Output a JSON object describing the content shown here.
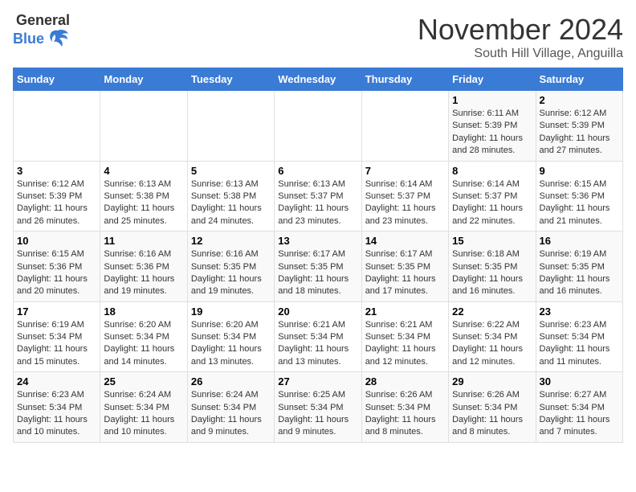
{
  "logo": {
    "general": "General",
    "blue": "Blue"
  },
  "title": "November 2024",
  "subtitle": "South Hill Village, Anguilla",
  "days_of_week": [
    "Sunday",
    "Monday",
    "Tuesday",
    "Wednesday",
    "Thursday",
    "Friday",
    "Saturday"
  ],
  "weeks": [
    [
      {
        "day": "",
        "info": ""
      },
      {
        "day": "",
        "info": ""
      },
      {
        "day": "",
        "info": ""
      },
      {
        "day": "",
        "info": ""
      },
      {
        "day": "",
        "info": ""
      },
      {
        "day": "1",
        "info": "Sunrise: 6:11 AM\nSunset: 5:39 PM\nDaylight: 11 hours and 28 minutes."
      },
      {
        "day": "2",
        "info": "Sunrise: 6:12 AM\nSunset: 5:39 PM\nDaylight: 11 hours and 27 minutes."
      }
    ],
    [
      {
        "day": "3",
        "info": "Sunrise: 6:12 AM\nSunset: 5:39 PM\nDaylight: 11 hours and 26 minutes."
      },
      {
        "day": "4",
        "info": "Sunrise: 6:13 AM\nSunset: 5:38 PM\nDaylight: 11 hours and 25 minutes."
      },
      {
        "day": "5",
        "info": "Sunrise: 6:13 AM\nSunset: 5:38 PM\nDaylight: 11 hours and 24 minutes."
      },
      {
        "day": "6",
        "info": "Sunrise: 6:13 AM\nSunset: 5:37 PM\nDaylight: 11 hours and 23 minutes."
      },
      {
        "day": "7",
        "info": "Sunrise: 6:14 AM\nSunset: 5:37 PM\nDaylight: 11 hours and 23 minutes."
      },
      {
        "day": "8",
        "info": "Sunrise: 6:14 AM\nSunset: 5:37 PM\nDaylight: 11 hours and 22 minutes."
      },
      {
        "day": "9",
        "info": "Sunrise: 6:15 AM\nSunset: 5:36 PM\nDaylight: 11 hours and 21 minutes."
      }
    ],
    [
      {
        "day": "10",
        "info": "Sunrise: 6:15 AM\nSunset: 5:36 PM\nDaylight: 11 hours and 20 minutes."
      },
      {
        "day": "11",
        "info": "Sunrise: 6:16 AM\nSunset: 5:36 PM\nDaylight: 11 hours and 19 minutes."
      },
      {
        "day": "12",
        "info": "Sunrise: 6:16 AM\nSunset: 5:35 PM\nDaylight: 11 hours and 19 minutes."
      },
      {
        "day": "13",
        "info": "Sunrise: 6:17 AM\nSunset: 5:35 PM\nDaylight: 11 hours and 18 minutes."
      },
      {
        "day": "14",
        "info": "Sunrise: 6:17 AM\nSunset: 5:35 PM\nDaylight: 11 hours and 17 minutes."
      },
      {
        "day": "15",
        "info": "Sunrise: 6:18 AM\nSunset: 5:35 PM\nDaylight: 11 hours and 16 minutes."
      },
      {
        "day": "16",
        "info": "Sunrise: 6:19 AM\nSunset: 5:35 PM\nDaylight: 11 hours and 16 minutes."
      }
    ],
    [
      {
        "day": "17",
        "info": "Sunrise: 6:19 AM\nSunset: 5:34 PM\nDaylight: 11 hours and 15 minutes."
      },
      {
        "day": "18",
        "info": "Sunrise: 6:20 AM\nSunset: 5:34 PM\nDaylight: 11 hours and 14 minutes."
      },
      {
        "day": "19",
        "info": "Sunrise: 6:20 AM\nSunset: 5:34 PM\nDaylight: 11 hours and 13 minutes."
      },
      {
        "day": "20",
        "info": "Sunrise: 6:21 AM\nSunset: 5:34 PM\nDaylight: 11 hours and 13 minutes."
      },
      {
        "day": "21",
        "info": "Sunrise: 6:21 AM\nSunset: 5:34 PM\nDaylight: 11 hours and 12 minutes."
      },
      {
        "day": "22",
        "info": "Sunrise: 6:22 AM\nSunset: 5:34 PM\nDaylight: 11 hours and 12 minutes."
      },
      {
        "day": "23",
        "info": "Sunrise: 6:23 AM\nSunset: 5:34 PM\nDaylight: 11 hours and 11 minutes."
      }
    ],
    [
      {
        "day": "24",
        "info": "Sunrise: 6:23 AM\nSunset: 5:34 PM\nDaylight: 11 hours and 10 minutes."
      },
      {
        "day": "25",
        "info": "Sunrise: 6:24 AM\nSunset: 5:34 PM\nDaylight: 11 hours and 10 minutes."
      },
      {
        "day": "26",
        "info": "Sunrise: 6:24 AM\nSunset: 5:34 PM\nDaylight: 11 hours and 9 minutes."
      },
      {
        "day": "27",
        "info": "Sunrise: 6:25 AM\nSunset: 5:34 PM\nDaylight: 11 hours and 9 minutes."
      },
      {
        "day": "28",
        "info": "Sunrise: 6:26 AM\nSunset: 5:34 PM\nDaylight: 11 hours and 8 minutes."
      },
      {
        "day": "29",
        "info": "Sunrise: 6:26 AM\nSunset: 5:34 PM\nDaylight: 11 hours and 8 minutes."
      },
      {
        "day": "30",
        "info": "Sunrise: 6:27 AM\nSunset: 5:34 PM\nDaylight: 11 hours and 7 minutes."
      }
    ]
  ]
}
